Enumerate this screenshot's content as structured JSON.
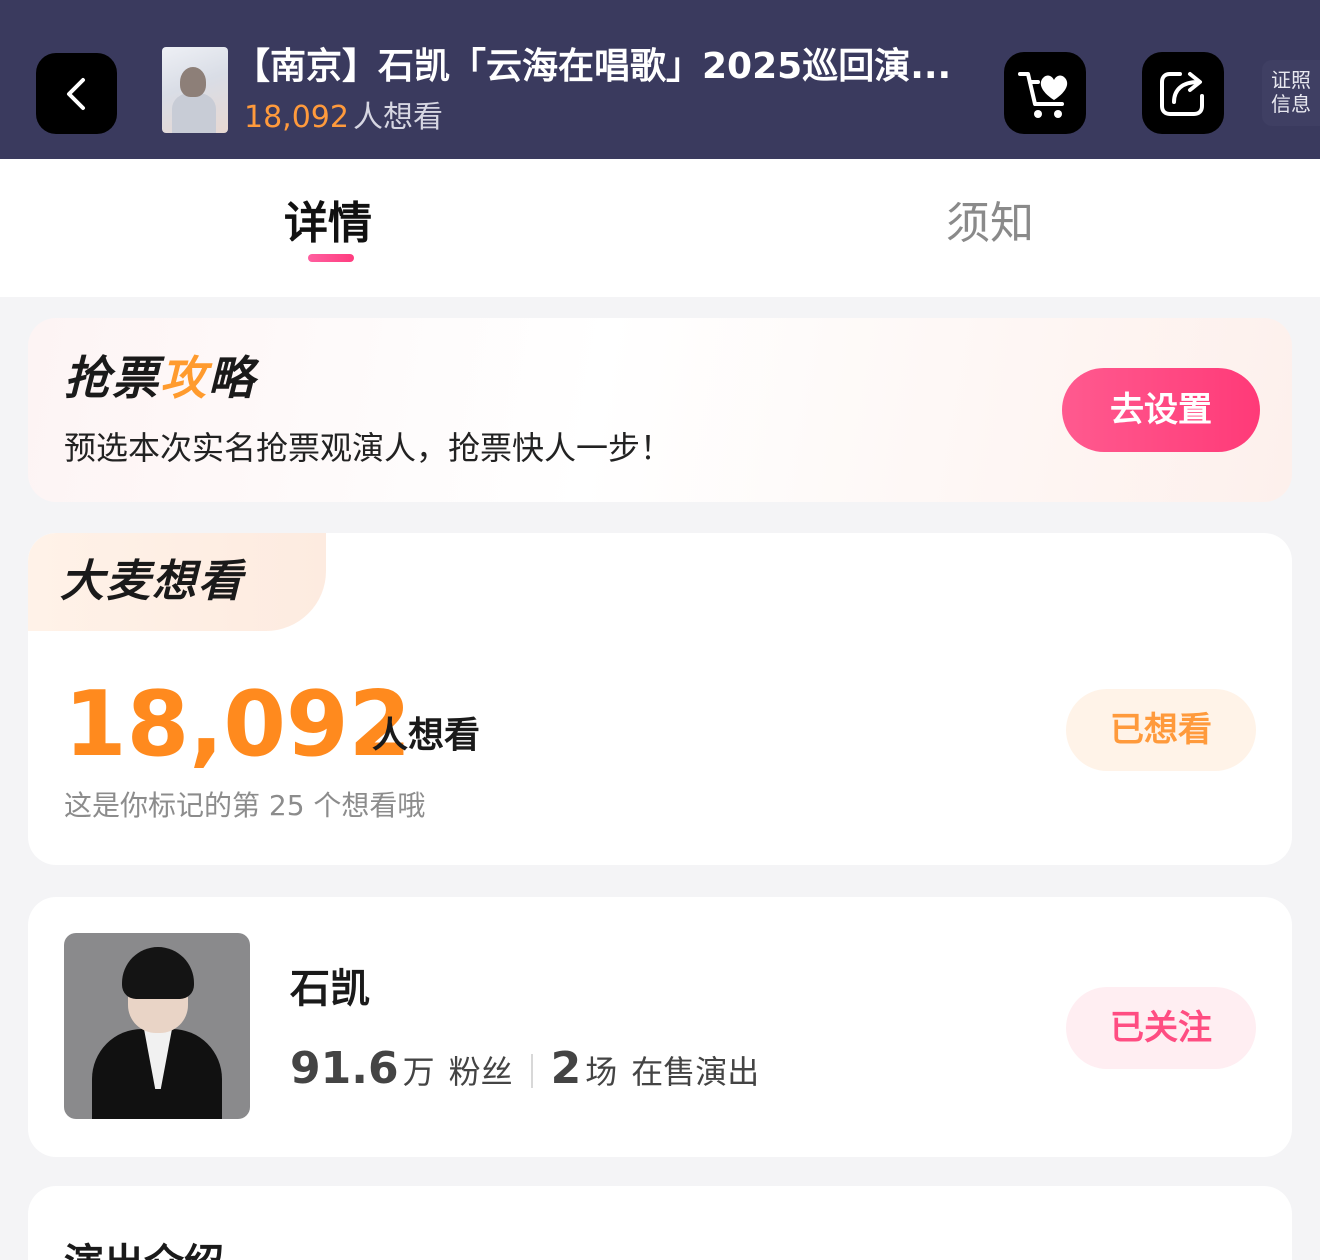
{
  "header": {
    "title": "【南京】石凯「云海在唱歌」2025巡回演...",
    "want_count": "18,092",
    "want_label": "人想看",
    "cert_line1": "证照",
    "cert_line2": "信息"
  },
  "tabs": [
    {
      "label": "详情",
      "active": true
    },
    {
      "label": "须知",
      "active": false
    }
  ],
  "strategy": {
    "title_part1": "抢票",
    "title_bolt": "攻",
    "title_part2": "略",
    "subtitle": "预选本次实名抢票观演人，抢票快人一步！",
    "button": "去设置"
  },
  "want": {
    "badge": "大麦想看",
    "count": "18,092",
    "unit": "人想看",
    "note": "这是你标记的第 25 个想看哦",
    "button": "已想看"
  },
  "artist": {
    "name": "石凯",
    "fans_num": "91.6",
    "fans_unit": "万",
    "fans_label": "粉丝",
    "shows_num": "2",
    "shows_unit": "场",
    "shows_label": "在售演出",
    "button": "已关注"
  },
  "intro": {
    "title": "演出介绍"
  },
  "colors": {
    "header_bg": "#3a3a5e",
    "accent_orange": "#ff8a1e",
    "accent_pink": "#ff3a78"
  },
  "icons": [
    "chevron-left-icon",
    "cart-heart-icon",
    "share-icon"
  ]
}
